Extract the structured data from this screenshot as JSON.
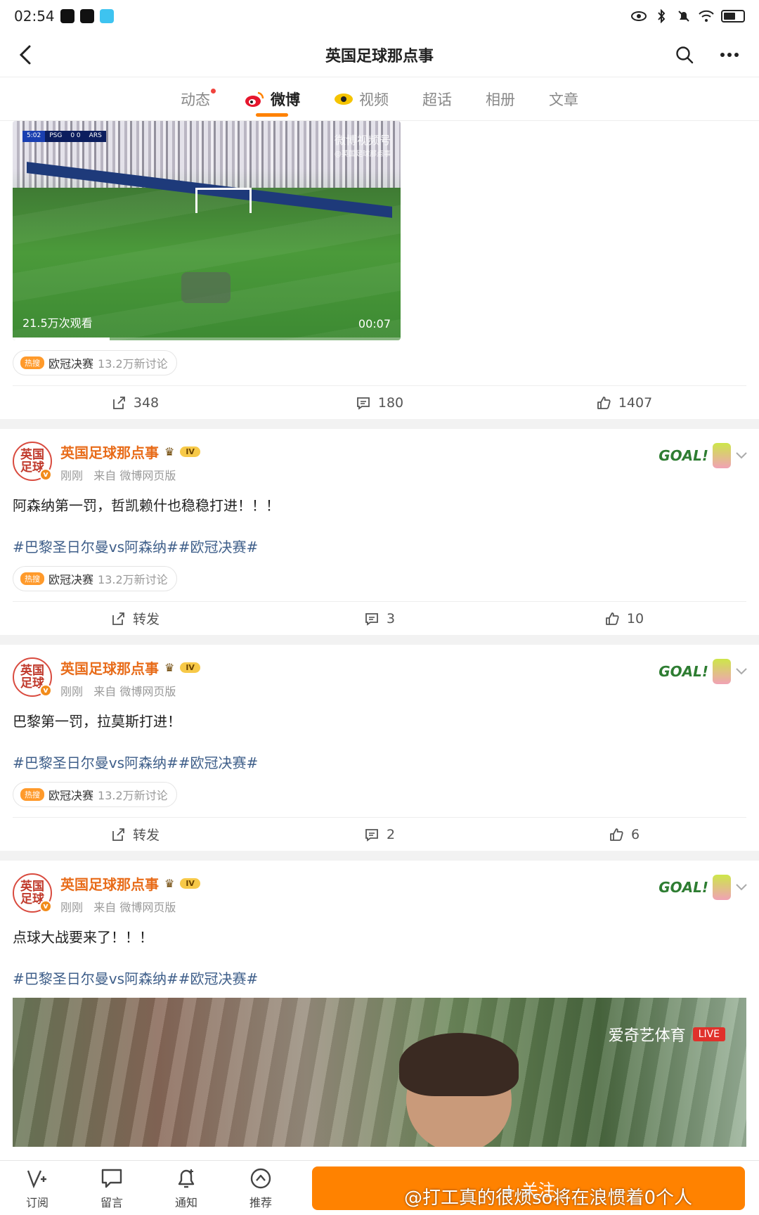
{
  "status_bar": {
    "time": "02:54"
  },
  "nav": {
    "title": "英国足球那点事"
  },
  "tabs": [
    {
      "label": "动态",
      "has_dot": true
    },
    {
      "label": "微博",
      "active": true
    },
    {
      "label": "视频"
    },
    {
      "label": "超话"
    },
    {
      "label": "相册"
    },
    {
      "label": "文章"
    }
  ],
  "video_post": {
    "scoreboard": {
      "time": "5:02",
      "home": "PSG",
      "score": "0  0",
      "away": "ARS"
    },
    "watermark": "微博视频号",
    "watermark_sub": "@英国足球那点事",
    "views": "21.5万次观看",
    "duration": "00:07",
    "progress": 0.25,
    "topic": {
      "hot_label": "热搜",
      "name": "欧冠决赛",
      "count": "13.2万新讨论"
    },
    "actions": {
      "repost": "348",
      "comment": "180",
      "like": "1407"
    }
  },
  "posts": [
    {
      "author": "英国足球那点事",
      "avatar_text": "英国足球",
      "level": "IV",
      "time": "刚刚",
      "source": "来自 微博网页版",
      "deco": "GOAL!",
      "text": "阿森纳第一罚，哲凯赖什也稳稳打进！！！",
      "tags": "#巴黎圣日尔曼vs阿森纳##欧冠决赛#",
      "topic": {
        "hot_label": "热搜",
        "name": "欧冠决赛",
        "count": "13.2万新讨论"
      },
      "actions": {
        "repost": "转发",
        "comment": "3",
        "like": "10"
      }
    },
    {
      "author": "英国足球那点事",
      "avatar_text": "英国足球",
      "level": "IV",
      "time": "刚刚",
      "source": "来自 微博网页版",
      "deco": "GOAL!",
      "text": "巴黎第一罚，拉莫斯打进！",
      "tags": "#巴黎圣日尔曼vs阿森纳##欧冠决赛#",
      "topic": {
        "hot_label": "热搜",
        "name": "欧冠决赛",
        "count": "13.2万新讨论"
      },
      "actions": {
        "repost": "转发",
        "comment": "2",
        "like": "6"
      }
    },
    {
      "author": "英国足球那点事",
      "avatar_text": "英国足球",
      "level": "IV",
      "time": "刚刚",
      "source": "来自 微博网页版",
      "deco": "GOAL!",
      "text": "点球大战要来了！！！",
      "tags": "#巴黎圣日尔曼vs阿森纳##欧冠决赛#",
      "image": {
        "tv_logo": "爱奇艺体育",
        "live": "LIVE"
      }
    }
  ],
  "bottom_bar": {
    "items": [
      {
        "label": "订阅",
        "icon": "subscribe-icon"
      },
      {
        "label": "留言",
        "icon": "message-icon"
      },
      {
        "label": "通知",
        "icon": "bell-plus-icon"
      },
      {
        "label": "推荐",
        "icon": "compass-icon"
      }
    ],
    "follow_label": "+ 关注"
  },
  "overlay_watermark": "@打工真的很烦so将在浪惯着0个人",
  "colors": {
    "accent": "#ff8200",
    "author": "#e86c1a",
    "tag": "#3f5f8a"
  }
}
